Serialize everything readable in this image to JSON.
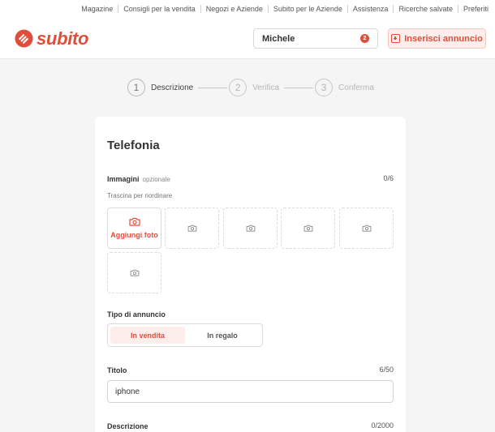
{
  "toplinks": [
    "Magazine",
    "Consigli per la vendita",
    "Negozi e Aziende",
    "Subito per le Aziende",
    "Assistenza",
    "Ricerche salvate",
    "Preferiti"
  ],
  "brand": {
    "name": "subito",
    "color": "#e04e3b"
  },
  "user": {
    "name": "Michele",
    "badge": "2"
  },
  "cta": {
    "label": "Inserisci annuncio",
    "icon": "plus-square-icon"
  },
  "steps": [
    {
      "number": "1",
      "label": "Descrizione",
      "active": true
    },
    {
      "number": "2",
      "label": "Verifica",
      "active": false
    },
    {
      "number": "3",
      "label": "Conferma",
      "active": false
    }
  ],
  "form": {
    "category": "Telefonia",
    "images": {
      "label": "Immagini",
      "optional": "opzionale",
      "counter": "0/6",
      "hint": "Trascina per riordinare",
      "add_label": "Aggiungi foto",
      "slots": 6,
      "icon": "camera-icon"
    },
    "ad_type": {
      "label": "Tipo di annuncio",
      "options": [
        "In vendita",
        "In regalo"
      ],
      "selected": "In vendita"
    },
    "title": {
      "label": "Titolo",
      "counter": "6/50",
      "value": "iphone"
    },
    "description": {
      "label": "Descrizione",
      "counter": "0/2000"
    }
  }
}
